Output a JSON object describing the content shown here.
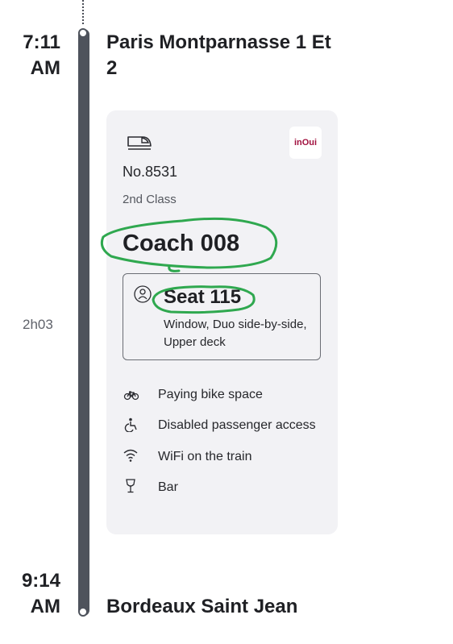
{
  "departure": {
    "time": "7:11 AM",
    "station": "Paris Montparnasse 1 Et 2"
  },
  "duration": "2h03",
  "train": {
    "icon": "train-icon",
    "brand_logo": "inOui",
    "number": "No.8531",
    "class": "2nd Class",
    "coach": "Coach 008",
    "seat": {
      "label": "Seat 115",
      "details": "Window, Duo side-by-side, Upper deck",
      "icon": "person-icon"
    },
    "amenities": [
      {
        "icon": "bike-icon",
        "label": "Paying bike space"
      },
      {
        "icon": "wheelchair-icon",
        "label": "Disabled passenger access"
      },
      {
        "icon": "wifi-icon",
        "label": "WiFi on the train"
      },
      {
        "icon": "wine-glass-icon",
        "label": "Bar"
      }
    ]
  },
  "arrival": {
    "time": "9:14 AM",
    "station": "Bordeaux Saint Jean"
  },
  "colors": {
    "rail": "#4e535c",
    "card_bg": "#f2f2f5",
    "annotation": "#2fa84f",
    "brand": "#a1103e"
  }
}
